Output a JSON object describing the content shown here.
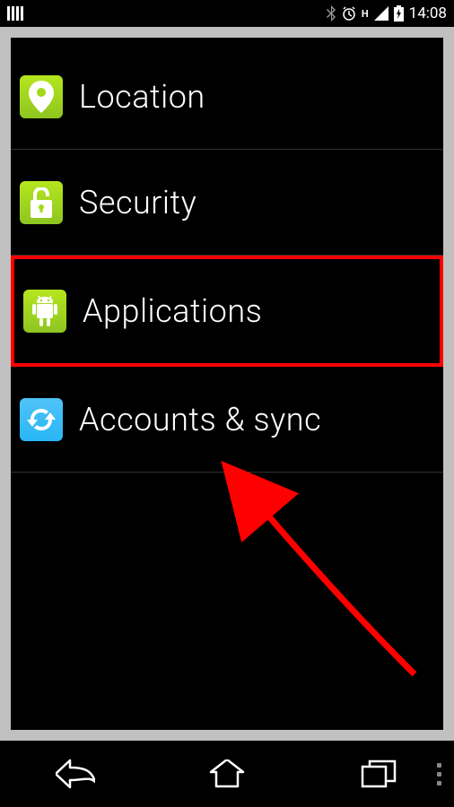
{
  "status": {
    "time": "14:08",
    "data_indicator": "H"
  },
  "settings": {
    "items": [
      {
        "label": "Location",
        "icon": "location-icon",
        "highlighted": false
      },
      {
        "label": "Security",
        "icon": "lock-icon",
        "highlighted": false
      },
      {
        "label": "Applications",
        "icon": "android-icon",
        "highlighted": true
      },
      {
        "label": "Accounts & sync",
        "icon": "sync-icon",
        "highlighted": false
      }
    ]
  }
}
